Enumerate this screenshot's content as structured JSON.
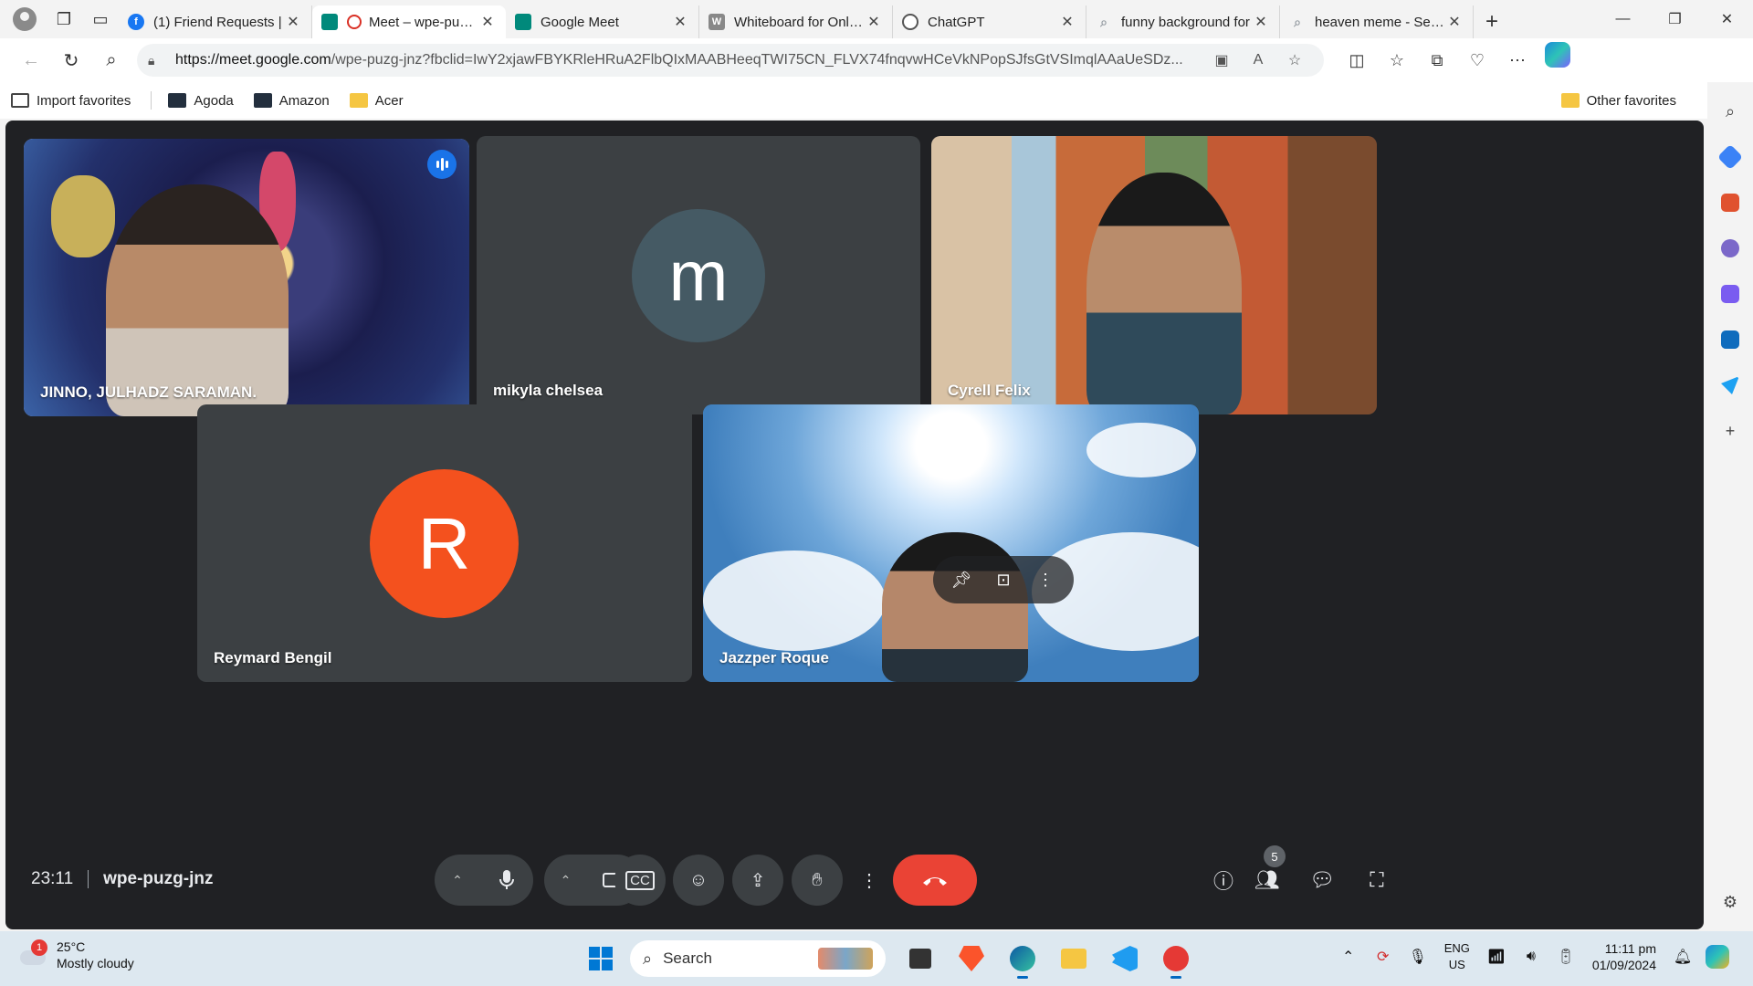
{
  "browser": {
    "tabs": [
      {
        "title": "(1) Friend Requests |",
        "favicon": "facebook-icon",
        "color": "#1877f2",
        "active": false
      },
      {
        "title": "Meet – wpe-puzg-jnz",
        "favicon": "google-meet-icon",
        "color": "#00897b",
        "active": true,
        "recording": true
      },
      {
        "title": "Google Meet",
        "favicon": "google-meet-icon",
        "color": "#00897b",
        "active": false
      },
      {
        "title": "Whiteboard for Online",
        "favicon": "whiteboard-w-icon",
        "color": "#888888",
        "active": false
      },
      {
        "title": "ChatGPT",
        "favicon": "chatgpt-icon",
        "color": "#555555",
        "active": false
      },
      {
        "title": "funny background for",
        "favicon": "search-icon",
        "color": "#9aa0a6",
        "active": false
      },
      {
        "title": "heaven meme - Search",
        "favicon": "search-icon",
        "color": "#9aa0a6",
        "active": false
      }
    ],
    "url_domain": "https://meet.google.com",
    "url_path": "/wpe-puzg-jnz?fbclid=IwY2xjawFBYKRleHRuA2FlbQIxMAABHeeqTWI75CN_FLVX74fnqvwHCeVkNPopSJfsGtVSImqlAAaUeSDz...",
    "favorites": [
      {
        "label": "Import favorites",
        "icon": "import-icon"
      },
      {
        "label": "Agoda",
        "icon": "agoda-icon"
      },
      {
        "label": "Amazon",
        "icon": "amazon-icon"
      },
      {
        "label": "Acer",
        "icon": "folder-icon"
      }
    ],
    "other_favorites": "Other favorites"
  },
  "meet": {
    "time": "23:11",
    "meeting_code": "wpe-puzg-jnz",
    "participant_count": "5",
    "participants": [
      {
        "name": "JINNO, JULHADZ SARAMAN.",
        "type": "video",
        "background": "space-scene",
        "speaking": true
      },
      {
        "name": "mikyla chelsea",
        "type": "avatar",
        "initial": "m",
        "avatar_color": "#455a64"
      },
      {
        "name": "Cyrell Felix",
        "type": "video",
        "background": "japanese-room"
      },
      {
        "name": "Reymard Bengil",
        "type": "avatar",
        "initial": "R",
        "avatar_color": "#f4511e"
      },
      {
        "name": "Jazzper Roque",
        "type": "video",
        "background": "heaven-sky"
      }
    ],
    "controls": {
      "end_call_color": "#ea4335",
      "panel_bg": "#3c4043"
    }
  },
  "taskbar": {
    "weather_temp": "25°C",
    "weather_desc": "Mostly cloudy",
    "weather_alert": "1",
    "search_label": "Search",
    "lang_top": "ENG",
    "lang_bottom": "US",
    "time": "11:11 pm",
    "date": "01/09/2024"
  }
}
